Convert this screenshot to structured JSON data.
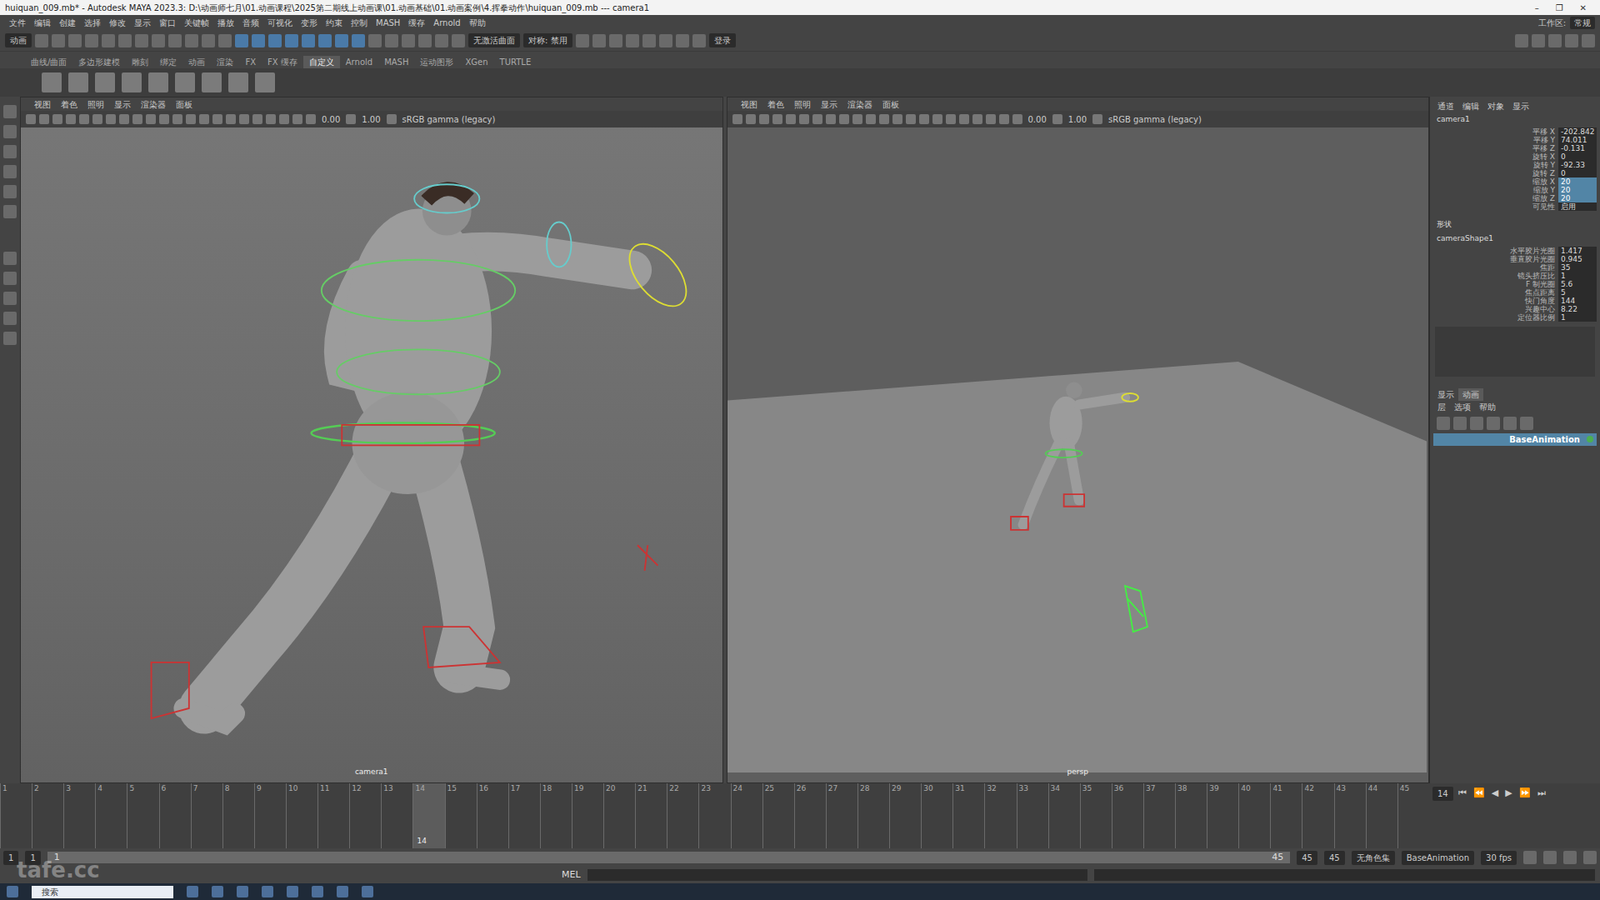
{
  "window": {
    "title": "huiquan_009.mb* - Autodesk MAYA 2023.3: D:\\动画师七月\\01.动画课程\\2025第二期线上动画课\\01.动画基础\\01.动画案例\\4.挥拳动作\\huiquan_009.mb  ---  camera1",
    "controls": [
      "–",
      "❐",
      "✕"
    ]
  },
  "menu": [
    "文件",
    "编辑",
    "创建",
    "选择",
    "修改",
    "显示",
    "窗口",
    "关键帧",
    "播放",
    "音频",
    "可视化",
    "变形",
    "约束",
    "控制",
    "MASH",
    "缓存",
    "Arnold",
    "帮助"
  ],
  "workspace": {
    "label": "工作区:",
    "value": "常规"
  },
  "status_line": {
    "mode": "动画",
    "live": "无激活曲面",
    "symmetry": "对称: 禁用",
    "login": "登录"
  },
  "shelf": {
    "tabs": [
      {
        "label": "曲线/曲面",
        "selected": false
      },
      {
        "label": "多边形建模",
        "selected": false
      },
      {
        "label": "雕刻",
        "selected": false
      },
      {
        "label": "绑定",
        "selected": false
      },
      {
        "label": "动画",
        "selected": false
      },
      {
        "label": "渲染",
        "selected": false
      },
      {
        "label": "FX",
        "selected": false
      },
      {
        "label": "FX 缓存",
        "selected": false
      },
      {
        "label": "自定义",
        "selected": true
      },
      {
        "label": "Arnold",
        "selected": false
      },
      {
        "label": "MASH",
        "selected": false
      },
      {
        "label": "运动图形",
        "selected": false
      },
      {
        "label": "XGen",
        "selected": false
      },
      {
        "label": "TURTLE",
        "selected": false
      }
    ]
  },
  "viewports": [
    {
      "menus": [
        "视图",
        "着色",
        "照明",
        "显示",
        "渲染器",
        "面板"
      ],
      "exposure": "0.00",
      "gamma": "1.00",
      "colorspace": "sRGB gamma (legacy)",
      "label": "camera1",
      "kind": "closeup"
    },
    {
      "menus": [
        "视图",
        "着色",
        "照明",
        "显示",
        "渲染器",
        "面板"
      ],
      "exposure": "0.00",
      "gamma": "1.00",
      "colorspace": "sRGB gamma (legacy)",
      "label": "persp",
      "kind": "wide"
    }
  ],
  "channel_box": {
    "tabs": [
      "通道",
      "编辑",
      "对象",
      "显示"
    ],
    "node": "camera1",
    "attributes": [
      {
        "name": "平移 X",
        "value": "-202.842",
        "selected": false
      },
      {
        "name": "平移 Y",
        "value": "74.011",
        "selected": false
      },
      {
        "name": "平移 Z",
        "value": "-0.131",
        "selected": false
      },
      {
        "name": "旋转 X",
        "value": "0",
        "selected": false
      },
      {
        "name": "旋转 Y",
        "value": "-92.33",
        "selected": false
      },
      {
        "name": "旋转 Z",
        "value": "0",
        "selected": false
      },
      {
        "name": "缩放 X",
        "value": "20",
        "selected": true
      },
      {
        "name": "缩放 Y",
        "value": "20",
        "selected": true
      },
      {
        "name": "缩放 Z",
        "value": "20",
        "selected": true
      },
      {
        "name": "可见性",
        "value": "启用",
        "selected": false
      }
    ],
    "shape_header": "形状",
    "shape": "cameraShape1",
    "shape_attributes": [
      {
        "name": "水平胶片光圈",
        "value": "1.417"
      },
      {
        "name": "垂直胶片光圈",
        "value": "0.945"
      },
      {
        "name": "焦距",
        "value": "35"
      },
      {
        "name": "镜头挤压比",
        "value": "1"
      },
      {
        "name": "F 制光圈",
        "value": "5.6"
      },
      {
        "name": "焦点距离",
        "value": "5"
      },
      {
        "name": "快门角度",
        "value": "144"
      },
      {
        "name": "兴趣中心",
        "value": "8.22"
      },
      {
        "name": "定位器比例",
        "value": "1"
      }
    ]
  },
  "layer_editor": {
    "tabs": [
      {
        "label": "显示",
        "selected": false
      },
      {
        "label": "动画",
        "selected": true
      }
    ],
    "menus": [
      "层",
      "选项",
      "帮助"
    ],
    "layers": [
      {
        "name": "BaseAnimation",
        "selected": true
      }
    ]
  },
  "timeline": {
    "ticks": [
      "1",
      "2",
      "3",
      "4",
      "5",
      "6",
      "7",
      "8",
      "9",
      "10",
      "11",
      "12",
      "13",
      "14",
      "15",
      "16",
      "17",
      "18",
      "19",
      "20",
      "21",
      "22",
      "23",
      "24",
      "25",
      "26",
      "27",
      "28",
      "29",
      "30",
      "31",
      "32",
      "33",
      "34",
      "35",
      "36",
      "37",
      "38",
      "39",
      "40",
      "41",
      "42",
      "43",
      "44",
      "45"
    ],
    "current": "14"
  },
  "playback": {
    "frame": "14",
    "buttons": [
      "⏮",
      "⏪",
      "◀",
      "▶",
      "⏩",
      "⏭"
    ]
  },
  "range": {
    "start": "1",
    "inner_start": "1",
    "slider_label": "1",
    "slider_end": "45",
    "inner_end": "45",
    "end": "45",
    "character_set": "无角色集",
    "anim_layer": "BaseAnimation",
    "fps": "30 fps"
  },
  "command_line": {
    "label": "MEL"
  },
  "taskbar": {
    "search": "搜索"
  },
  "watermark": "tafe.cc"
}
